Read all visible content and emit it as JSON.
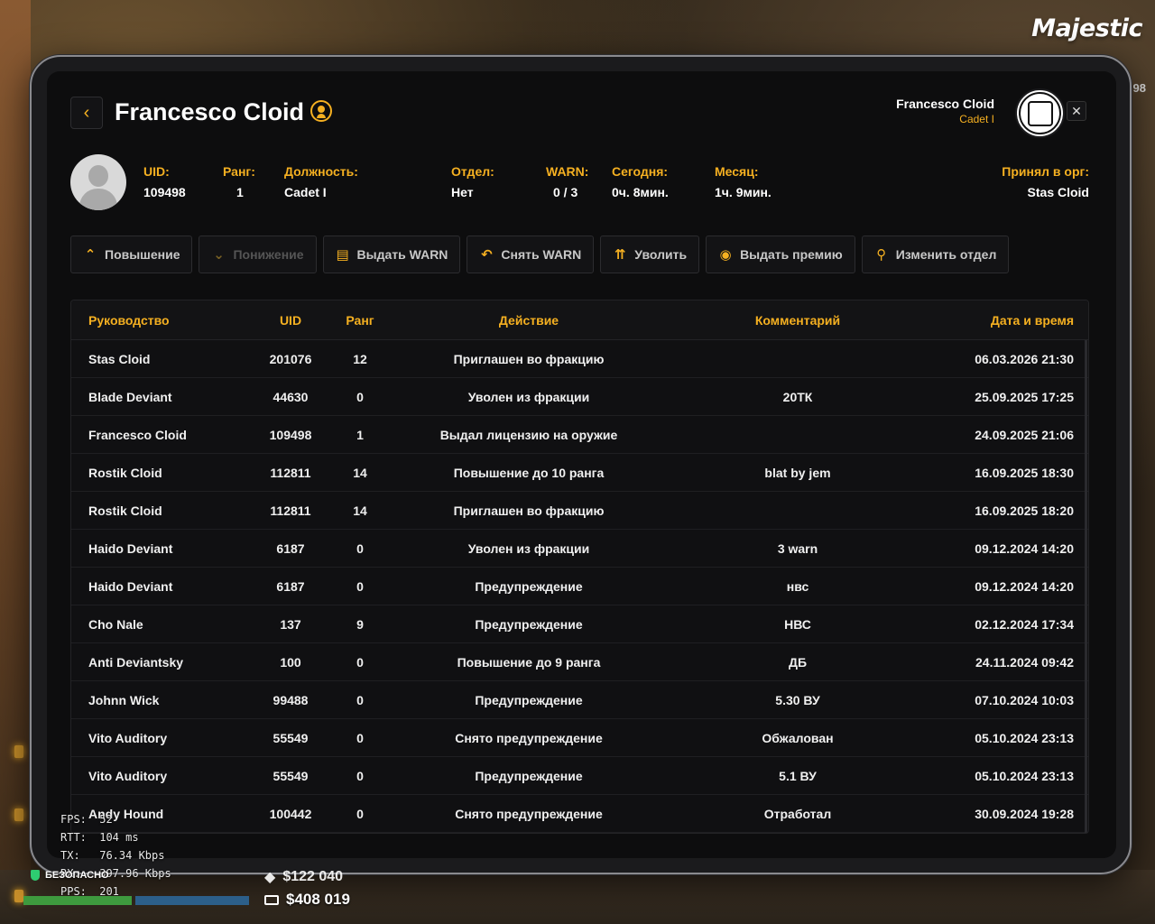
{
  "brand": {
    "logo_text": "Majestic"
  },
  "header": {
    "back_icon": "chevron-left-icon",
    "title": "Francesco Cloid",
    "title_badge_icon": "user-circle-icon",
    "profile_name": "Francesco Cloid",
    "profile_rank": "Cadet I",
    "emblem_icon": "police-emblem-icon",
    "close_icon": "close-icon"
  },
  "info": {
    "uid_label": "UID:",
    "uid_value": "109498",
    "rank_label": "Ранг:",
    "rank_value": "1",
    "position_label": "Должность:",
    "position_value": "Cadet I",
    "department_label": "Отдел:",
    "department_value": "Нет",
    "warn_label": "WARN:",
    "warn_value": "0 / 3",
    "today_label": "Сегодня:",
    "today_value": "0ч. 8мин.",
    "month_label": "Месяц:",
    "month_value": "1ч. 9мин.",
    "accepted_label": "Принял в орг:",
    "accepted_value": "Stas Cloid"
  },
  "actions": [
    {
      "label": "Повышение",
      "icon": "chevron-up-icon",
      "enabled": true
    },
    {
      "label": "Понижение",
      "icon": "chevron-down-icon",
      "enabled": false
    },
    {
      "label": "Выдать WARN",
      "icon": "document-warn-icon",
      "enabled": true
    },
    {
      "label": "Снять WARN",
      "icon": "undo-arrow-icon",
      "enabled": true
    },
    {
      "label": "Уволить",
      "icon": "person-leave-icon",
      "enabled": true
    },
    {
      "label": "Выдать премию",
      "icon": "coin-icon",
      "enabled": true
    },
    {
      "label": "Изменить отдел",
      "icon": "hierarchy-icon",
      "enabled": true
    }
  ],
  "table": {
    "columns": {
      "leader": "Руководство",
      "uid": "UID",
      "rank": "Ранг",
      "action": "Действие",
      "comment": "Комментарий",
      "datetime": "Дата и время"
    },
    "rows": [
      {
        "leader": "Stas Cloid",
        "uid": "201076",
        "rank": "12",
        "action": "Приглашен во фракцию",
        "comment": "",
        "datetime": "06.03.2026 21:30"
      },
      {
        "leader": "Blade Deviant",
        "uid": "44630",
        "rank": "0",
        "action": "Уволен из фракции",
        "comment": "20ТК",
        "datetime": "25.09.2025 17:25"
      },
      {
        "leader": "Francesco Cloid",
        "uid": "109498",
        "rank": "1",
        "action": "Выдал лицензию на оружие",
        "comment": "",
        "datetime": "24.09.2025 21:06"
      },
      {
        "leader": "Rostik Cloid",
        "uid": "112811",
        "rank": "14",
        "action": "Повышение до 10 ранга",
        "comment": "blat by jem",
        "datetime": "16.09.2025 18:30"
      },
      {
        "leader": "Rostik Cloid",
        "uid": "112811",
        "rank": "14",
        "action": "Приглашен во фракцию",
        "comment": "",
        "datetime": "16.09.2025 18:20"
      },
      {
        "leader": "Haido Deviant",
        "uid": "6187",
        "rank": "0",
        "action": "Уволен из фракции",
        "comment": "3 warn",
        "datetime": "09.12.2024 14:20"
      },
      {
        "leader": "Haido Deviant",
        "uid": "6187",
        "rank": "0",
        "action": "Предупреждение",
        "comment": "нвс",
        "datetime": "09.12.2024 14:20"
      },
      {
        "leader": "Cho Nale",
        "uid": "137",
        "rank": "9",
        "action": "Предупреждение",
        "comment": "НВС",
        "datetime": "02.12.2024 17:34"
      },
      {
        "leader": "Anti Deviantsky",
        "uid": "100",
        "rank": "0",
        "action": "Повышение до 9 ранга",
        "comment": "ДБ",
        "datetime": "24.11.2024 09:42"
      },
      {
        "leader": "Johnn Wick",
        "uid": "99488",
        "rank": "0",
        "action": "Предупреждение",
        "comment": "5.30 ВУ",
        "datetime": "07.10.2024 10:03"
      },
      {
        "leader": "Vito Auditory",
        "uid": "55549",
        "rank": "0",
        "action": "Снято предупреждение",
        "comment": "Обжалован",
        "datetime": "05.10.2024 23:13"
      },
      {
        "leader": "Vito Auditory",
        "uid": "55549",
        "rank": "0",
        "action": "Предупреждение",
        "comment": "5.1 ВУ",
        "datetime": "05.10.2024 23:13"
      },
      {
        "leader": "Andy Hound",
        "uid": "100442",
        "rank": "0",
        "action": "Снято предупреждение",
        "comment": "Отработал",
        "datetime": "30.09.2024 19:28"
      }
    ]
  },
  "hud": {
    "fps_label": "FPS:",
    "fps_value": "52",
    "rtt_label": "RTT:",
    "rtt_value": "104 ms",
    "tx_label": "TX:",
    "tx_value": "76.34 Kbps",
    "rx_label": "RX:",
    "rx_value": "397.96 Kbps",
    "pps_label": "PPS:",
    "pps_value": "201",
    "safe_label": "БЕЗОПАСНО",
    "cash_top": "$122 040",
    "bank": "$408 019",
    "side_number": "98"
  },
  "colors": {
    "accent": "#f5b021",
    "screen_bg": "#0d0d0e"
  }
}
